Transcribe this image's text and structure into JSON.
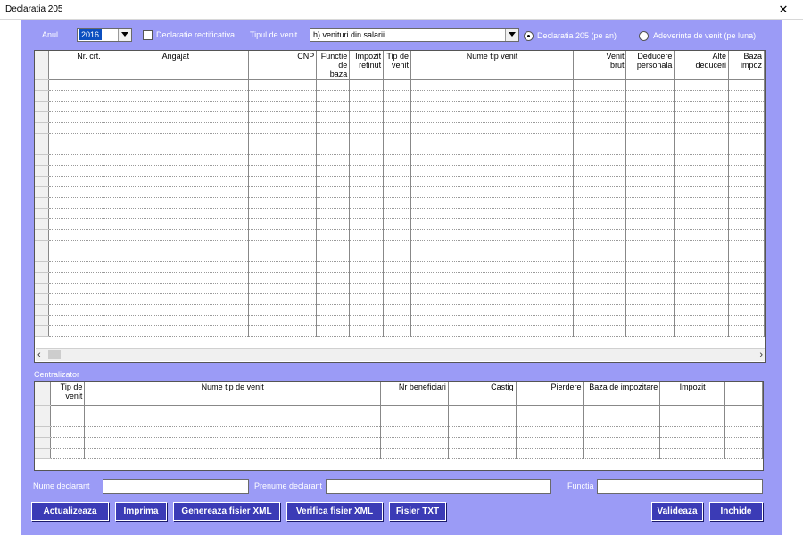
{
  "window": {
    "title": "Declaratia 205",
    "close_glyph": "✕"
  },
  "filters": {
    "year_label": "Anul",
    "year_value": "2016",
    "rectificativa_label": "Declaratie rectificativa",
    "tip_venit_label": "Tipul de venit",
    "tip_venit_value": "h) venituri din salarii",
    "radio_declaratie": "Declaratia 205 (pe an)",
    "radio_adeverinta": "Adeverinta de venit (pe luna)"
  },
  "main_table": {
    "columns": [
      [
        "Nr. crt."
      ],
      [
        "Angajat"
      ],
      [
        "CNP"
      ],
      [
        "Functie",
        "de baza"
      ],
      [
        "Impozit",
        "retinut"
      ],
      [
        "Tip de",
        "venit"
      ],
      [
        "Nume tip venit"
      ],
      [
        "Venit",
        "brut"
      ],
      [
        "Deducere",
        "personala"
      ],
      [
        "Alte",
        "deduceri"
      ],
      [
        "Baza",
        "impoz"
      ]
    ]
  },
  "centralizator": {
    "label": "Centralizator",
    "columns": [
      [
        "Tip de",
        "venit"
      ],
      [
        "Nume tip de venit"
      ],
      [
        "Nr beneficiari"
      ],
      [
        "Castig"
      ],
      [
        "Pierdere"
      ],
      [
        "Baza de impozitare"
      ],
      [
        "Impozit"
      ],
      [
        ""
      ]
    ]
  },
  "declarant": {
    "nume_label": "Nume declarant",
    "prenume_label": "Prenume declarant",
    "functia_label": "Functia"
  },
  "buttons": {
    "actualizeaza": "Actualizeaza",
    "imprima": "Imprima",
    "genereaza_xml": "Genereaza fisier XML",
    "verifica_xml": "Verifica fisier XML",
    "fisier_txt": "Fisier TXT",
    "valideaza": "Valideaza",
    "inchide": "Inchide"
  },
  "scroll": {
    "left_arrow": "‹",
    "right_arrow": "›"
  }
}
